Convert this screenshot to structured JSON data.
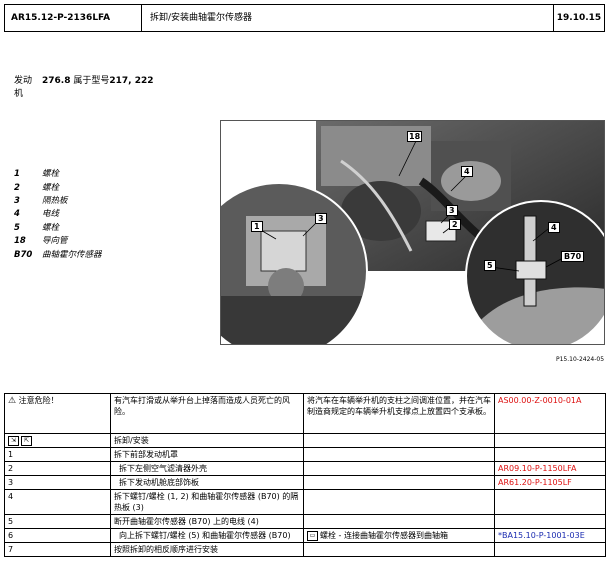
{
  "header": {
    "doc_id": "AR15.12-P-2136LFA",
    "title": "拆卸/安装曲轴霍尔传感器",
    "date": "19.10.15"
  },
  "engine": {
    "label_line1": "发动",
    "label_line2": "机",
    "model": "276.8",
    "text_mid": "属于型号",
    "types": "217, 222"
  },
  "legend": [
    {
      "num": "1",
      "text": "螺栓"
    },
    {
      "num": "2",
      "text": "螺栓"
    },
    {
      "num": "3",
      "text": "隔热板"
    },
    {
      "num": "4",
      "text": "电线"
    },
    {
      "num": "5",
      "text": "螺栓"
    },
    {
      "num": "18",
      "text": "导向管"
    },
    {
      "num": "B70",
      "text": "曲轴霍尔传感器"
    }
  ],
  "figure": {
    "callouts": {
      "c18": "18",
      "c4": "4",
      "c3": "3",
      "c2": "2",
      "c1": "1",
      "c3b": "3",
      "z4": "4",
      "z5": "5",
      "zB70": "B70"
    },
    "caption": "P15.10-2424-05"
  },
  "table": {
    "danger": {
      "label": "注意危险！",
      "text": "有汽车打滑或从举升台上掉落而造成人员死亡的风险。",
      "measure": "将汽车在车辆举升机的支柱之间调准位置，并在汽车制造商规定的车辆举升机支撑点上放置四个支承板。",
      "ref": "AS00.00-Z-0010-01A"
    },
    "section": "拆卸/安装",
    "steps": [
      {
        "num": "1",
        "text": "拆下前部发动机罩",
        "note": "",
        "ref": ""
      },
      {
        "num": "2",
        "text": "拆下左侧空气滤清器外壳",
        "note": "",
        "ref": "AR09.10-P-1150LFA"
      },
      {
        "num": "3",
        "text": "拆下发动机舱底部饰板",
        "note": "",
        "ref": "AR61.20-P-1105LF"
      },
      {
        "num": "4",
        "text": "拆下螺钉/螺栓 (1, 2) 和曲轴霍尔传感器 (B70) 的隔热板 (3)",
        "note": "",
        "ref": ""
      },
      {
        "num": "5",
        "text": "断开曲轴霍尔传感器 (B70) 上的电线 (4)",
        "note": "",
        "ref": ""
      },
      {
        "num": "6",
        "text": "向上拆下螺钉/螺栓 (5) 和曲轴霍尔传感器 (B70)",
        "note": "螺栓 - 连接曲轴霍尔传感器到曲轴箱",
        "ref": "*BA15.10-P-1001-03E"
      },
      {
        "num": "7",
        "text": "按照拆卸的相反顺序进行安装",
        "note": "",
        "ref": ""
      }
    ]
  }
}
